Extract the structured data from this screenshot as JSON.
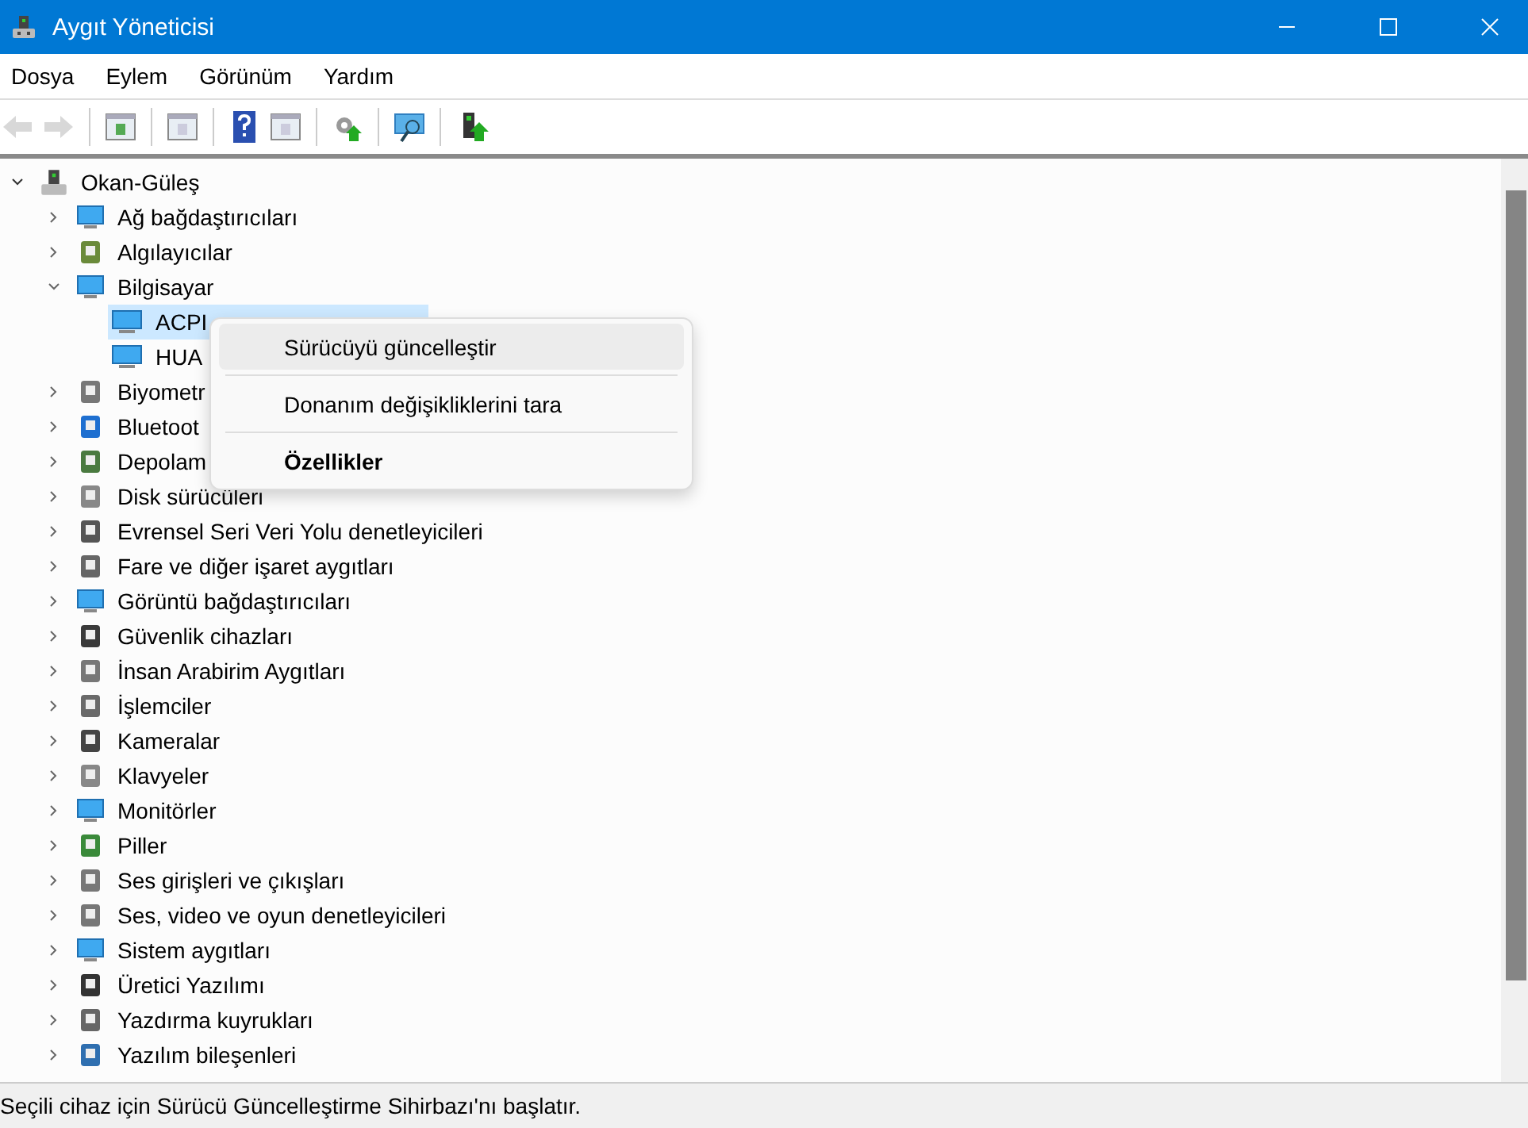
{
  "window": {
    "title": "Aygıt Yöneticisi"
  },
  "menu": [
    "Dosya",
    "Eylem",
    "Görünüm",
    "Yardım"
  ],
  "toolbar": [
    {
      "buttons": [
        {
          "disabled": true
        },
        {
          "disabled": true
        }
      ]
    },
    {
      "buttons": [
        {
          "disabled": false
        }
      ]
    },
    {
      "buttons": [
        {
          "disabled": false
        }
      ]
    },
    {
      "buttons": [
        {
          "disabled": false
        },
        {
          "disabled": false
        }
      ]
    },
    {
      "buttons": [
        {
          "disabled": false
        }
      ]
    },
    {
      "buttons": [
        {
          "disabled": false
        }
      ]
    },
    {
      "buttons": [
        {
          "disabled": false
        }
      ]
    }
  ],
  "tree": {
    "label": "Okan-Güleş",
    "expanded": true,
    "selected": false,
    "children": [
      {
        "label": "Ağ bağdaştırıcıları",
        "expanded": false,
        "selected": false
      },
      {
        "label": "Algılayıcılar",
        "expanded": false,
        "selected": false
      },
      {
        "label": "Bilgisayar",
        "expanded": true,
        "selected": false,
        "children": [
          {
            "label": "ACPI",
            "selected": true
          },
          {
            "label": "HUA",
            "selected": false
          }
        ]
      },
      {
        "label": "Biyometr",
        "expanded": false,
        "selected": false
      },
      {
        "label": "Bluetoot",
        "expanded": false,
        "selected": false
      },
      {
        "label": "Depolam",
        "expanded": false,
        "selected": false
      },
      {
        "label": "Disk sürücüleri",
        "expanded": false,
        "selected": false
      },
      {
        "label": "Evrensel Seri Veri Yolu denetleyicileri",
        "expanded": false,
        "selected": false
      },
      {
        "label": "Fare ve diğer işaret aygıtları",
        "expanded": false,
        "selected": false
      },
      {
        "label": "Görüntü bağdaştırıcıları",
        "expanded": false,
        "selected": false
      },
      {
        "label": "Güvenlik cihazları",
        "expanded": false,
        "selected": false
      },
      {
        "label": "İnsan Arabirim Aygıtları",
        "expanded": false,
        "selected": false
      },
      {
        "label": "İşlemciler",
        "expanded": false,
        "selected": false
      },
      {
        "label": "Kameralar",
        "expanded": false,
        "selected": false
      },
      {
        "label": "Klavyeler",
        "expanded": false,
        "selected": false
      },
      {
        "label": "Monitörler",
        "expanded": false,
        "selected": false
      },
      {
        "label": "Piller",
        "expanded": false,
        "selected": false
      },
      {
        "label": "Ses girişleri ve çıkışları",
        "expanded": false,
        "selected": false
      },
      {
        "label": "Ses, video ve oyun denetleyicileri",
        "expanded": false,
        "selected": false
      },
      {
        "label": "Sistem aygıtları",
        "expanded": false,
        "selected": false
      },
      {
        "label": "Üretici Yazılımı",
        "expanded": false,
        "selected": false
      },
      {
        "label": "Yazdırma kuyrukları",
        "expanded": false,
        "selected": false
      },
      {
        "label": "Yazılım bileşenleri",
        "expanded": false,
        "selected": false
      }
    ]
  },
  "context_menu": [
    {
      "kind": "item",
      "label": "Sürücüyü güncelleştir",
      "selected": true,
      "default": false
    },
    {
      "kind": "separator"
    },
    {
      "kind": "item",
      "label": "Donanım değişikliklerini tara",
      "selected": false,
      "default": false
    },
    {
      "kind": "separator"
    },
    {
      "kind": "item",
      "label": "Özellikler",
      "selected": false,
      "default": true
    }
  ],
  "status_bar": "Seçili cihaz için Sürücü Güncelleştirme Sihirbazı'nı başlatır."
}
